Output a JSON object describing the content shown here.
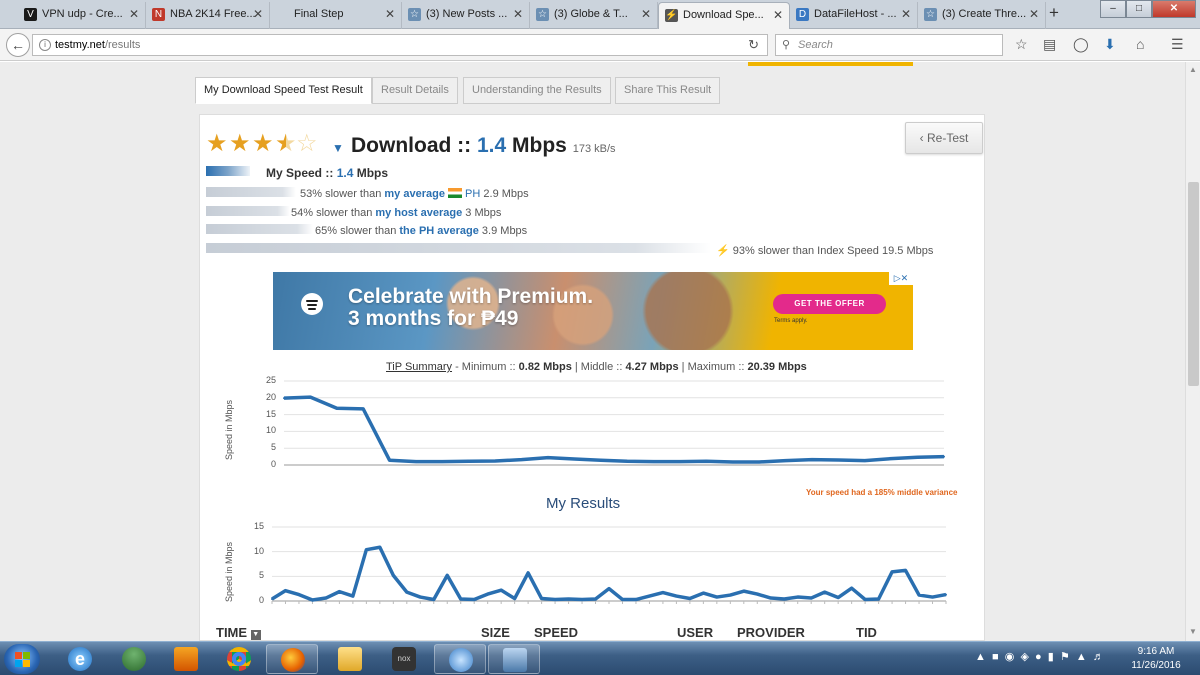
{
  "browser": {
    "tabs": [
      {
        "title": "VPN udp - Cre...",
        "icon_color": "#1a1a1a",
        "icon": "V"
      },
      {
        "title": "NBA 2K14 Free...",
        "icon_color": "#c0392b",
        "icon": "N"
      },
      {
        "title": "Final Step",
        "icon_color": "",
        "icon": ""
      },
      {
        "title": "(3) New Posts ...",
        "icon_color": "#6b8fb3",
        "icon": "☆"
      },
      {
        "title": "(3) Globe & T...",
        "icon_color": "#6b8fb3",
        "icon": "☆"
      },
      {
        "title": "Download Spe...",
        "icon_color": "#555",
        "icon": "⚡"
      },
      {
        "title": "DataFileHost - ...",
        "icon_color": "#3a78c2",
        "icon": "D"
      },
      {
        "title": "(3) Create Thre...",
        "icon_color": "#6b8fb3",
        "icon": "☆"
      }
    ],
    "active_tab_index": 5,
    "url_host": "testmy.net",
    "url_path": "/results",
    "search_placeholder": "Search"
  },
  "result_tabs": [
    "My Download Speed Test Result",
    "Result Details",
    "Understanding the Results",
    "Share This Result"
  ],
  "result": {
    "rating_stars": 3.5,
    "title_prefix": "Download :: ",
    "title_value": "1.4",
    "title_unit": " Mbps",
    "kbs": "173 kB/s",
    "retest_label": "‹ Re-Test",
    "my_speed_label": "My Speed :: ",
    "my_speed_value": "1.4",
    "my_speed_unit": " Mbps",
    "comparisons": [
      {
        "pct_text": "53% slower than ",
        "link": "my average",
        "extra": " PH",
        "value": " 2.9 Mbps"
      },
      {
        "pct_text": "54% slower than ",
        "link": "my host average",
        "extra": "",
        "value": " 3 Mbps"
      },
      {
        "pct_text": "65% slower than ",
        "link": "the PH average",
        "extra": "",
        "value": " 3.9 Mbps"
      },
      {
        "pct_text": "93% slower than Index Speed ",
        "link": "",
        "extra": "",
        "value": "19.5 Mbps"
      }
    ]
  },
  "ad": {
    "headline_1": "Celebrate with Premium.",
    "headline_2": "3 months for ₱49",
    "cta": "GET THE OFFER",
    "terms": "Terms apply.",
    "ad_close": "▷✕"
  },
  "tip": {
    "label": "TiP Summary",
    "minimum_label": " - Minimum :: ",
    "minimum": "0.82 Mbps",
    "middle_label": " | Middle :: ",
    "middle": "4.27 Mbps",
    "maximum_label": " | Maximum :: ",
    "maximum": "20.39 Mbps"
  },
  "variance_note": "Your speed had a 185% middle variance",
  "my_results_heading": "My Results",
  "table_headers": [
    "TIME",
    "SIZE",
    "SPEED",
    "USER",
    "PROVIDER",
    "TID"
  ],
  "colors": {
    "accent": "#2a6fb0",
    "line": "#2a6fb0",
    "variance": "#e0671f"
  },
  "chart_data": [
    {
      "type": "line",
      "title": "",
      "ylabel": "Speed in Mbps",
      "ylim": [
        0,
        25
      ],
      "yticks": [
        0,
        5,
        10,
        15,
        20,
        25
      ],
      "x": [
        1,
        2,
        3,
        4,
        5,
        6,
        7,
        8,
        9,
        10,
        11,
        12,
        13,
        14,
        15,
        16,
        17,
        18,
        19,
        20,
        21,
        22,
        23,
        24,
        25,
        26
      ],
      "series": [
        {
          "values": [
            19.9,
            20.2,
            16.9,
            16.7,
            1.4,
            1.0,
            1.0,
            1.1,
            1.2,
            1.6,
            2.2,
            1.8,
            1.4,
            1.1,
            1.0,
            1.0,
            1.1,
            0.9,
            0.9,
            1.3,
            1.6,
            1.5,
            1.3,
            1.9,
            2.3,
            2.5
          ]
        }
      ]
    },
    {
      "type": "line",
      "title": "",
      "ylabel": "Speed in Mbps",
      "ylim": [
        0,
        15
      ],
      "yticks": [
        0,
        5,
        10,
        15
      ],
      "x": [
        1,
        2,
        3,
        4,
        5,
        6,
        7,
        8,
        9,
        10,
        11,
        12,
        13,
        14,
        15,
        16,
        17,
        18,
        19,
        20,
        21,
        22,
        23,
        24,
        25,
        26,
        27,
        28,
        29,
        30,
        31,
        32,
        33,
        34,
        35,
        36,
        37,
        38,
        39,
        40,
        41,
        42,
        43,
        44,
        45,
        46,
        47,
        48,
        49,
        50,
        51
      ],
      "series": [
        {
          "values": [
            0.4,
            2.1,
            1.3,
            0.2,
            0.6,
            1.9,
            1.0,
            10.4,
            10.9,
            5.2,
            1.8,
            0.8,
            0.3,
            5.2,
            0.4,
            0.3,
            1.4,
            2.2,
            0.5,
            5.7,
            0.5,
            0.3,
            0.4,
            0.3,
            0.4,
            2.5,
            0.3,
            0.3,
            1.0,
            1.7,
            1.0,
            0.5,
            1.6,
            0.8,
            1.2,
            2.0,
            1.4,
            0.6,
            0.4,
            0.8,
            0.6,
            1.8,
            0.7,
            2.6,
            0.3,
            0.4,
            5.9,
            6.2,
            1.2,
            0.8,
            1.3
          ]
        }
      ]
    }
  ],
  "taskbar": {
    "time": "9:16 AM",
    "date": "11/26/2016"
  }
}
